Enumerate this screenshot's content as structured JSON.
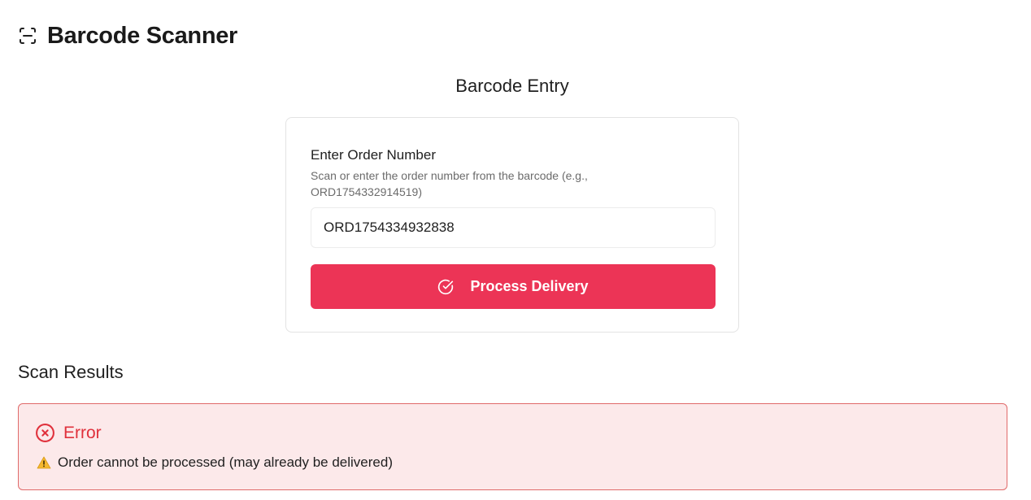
{
  "header": {
    "title": "Barcode Scanner",
    "icon": "scan-icon"
  },
  "barcode_entry": {
    "title": "Barcode Entry",
    "field_label": "Enter Order Number",
    "field_help": "Scan or enter the order number from the barcode (e.g., ORD1754332914519)",
    "input_value": "ORD1754334932838",
    "button_label": "Process Delivery",
    "button_icon": "check-circle-icon",
    "accent_color": "#ec3456"
  },
  "results": {
    "title": "Scan Results",
    "error": {
      "title": "Error",
      "icon": "x-circle-icon",
      "message": "Order cannot be processed (may already be delivered)",
      "message_icon": "warning-icon",
      "color": "#e0313c",
      "background": "#fce9ea"
    }
  }
}
